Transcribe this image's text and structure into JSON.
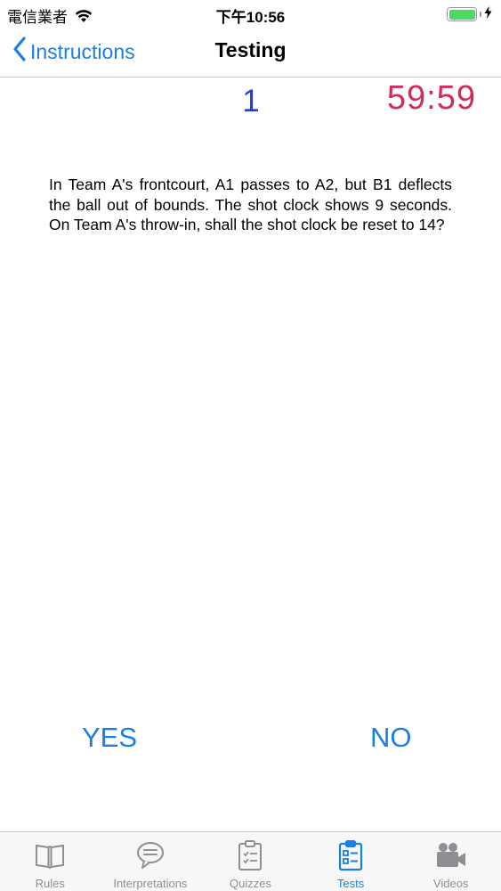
{
  "status_bar": {
    "carrier": "電信業者",
    "time": "下午10:56"
  },
  "nav": {
    "back_label": "Instructions",
    "title": "Testing"
  },
  "question": {
    "number": "1",
    "timer": "59:59",
    "text": "In Team A's frontcourt, A1 passes to A2, but B1 deflects the ball out of bounds. The shot clock shows 9 seconds. On Team A's throw-in, shall the shot clock be reset to 14?"
  },
  "answers": {
    "yes_label": "YES",
    "no_label": "NO"
  },
  "tabs": [
    {
      "label": "Rules",
      "icon": "book-icon",
      "active": false
    },
    {
      "label": "Interpretations",
      "icon": "speech-bubble-icon",
      "active": false
    },
    {
      "label": "Quizzes",
      "icon": "clipboard-check-icon",
      "active": false
    },
    {
      "label": "Tests",
      "icon": "clipboard-list-icon",
      "active": true
    },
    {
      "label": "Videos",
      "icon": "video-camera-icon",
      "active": false
    }
  ],
  "colors": {
    "accent": "#1a7fe0",
    "question_number": "#1f3fd6",
    "timer": "#d42c58",
    "battery": "#4cd964",
    "inactive_tab": "#8e8e93"
  }
}
